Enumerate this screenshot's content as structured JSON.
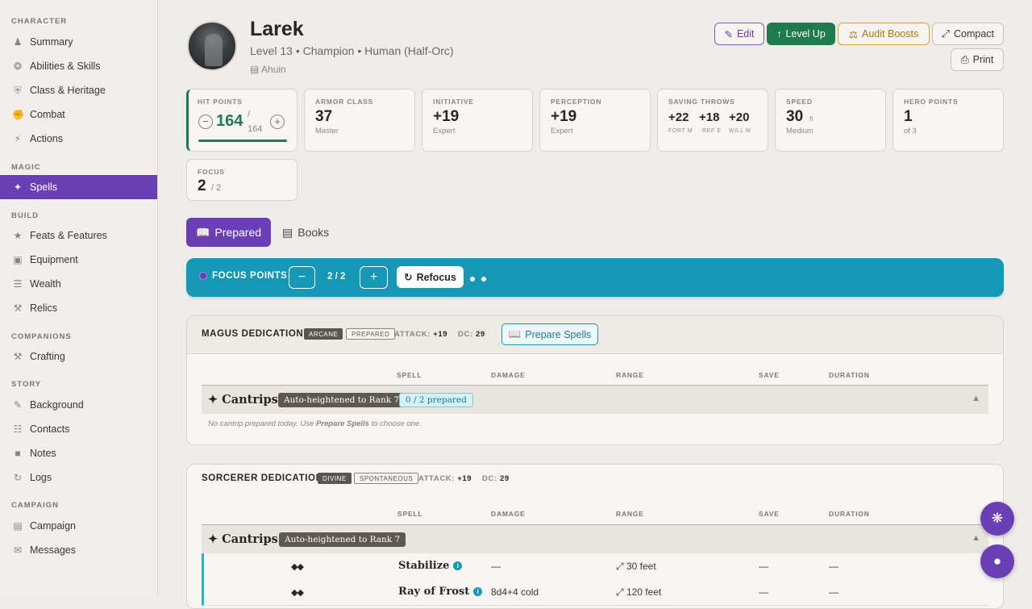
{
  "sidebar": {
    "sections": {
      "character": "CHARACTER",
      "magic": "MAGIC",
      "build": "BUILD",
      "companions": "COMPANIONS",
      "story": "STORY",
      "campaign": "CAMPAIGN"
    },
    "items": [
      {
        "label": "Summary",
        "icon": "person-icon"
      },
      {
        "label": "Abilities & Skills",
        "icon": "brain-icon"
      },
      {
        "label": "Class & Heritage",
        "icon": "shield-icon"
      },
      {
        "label": "Combat",
        "icon": "fist-icon"
      },
      {
        "label": "Actions",
        "icon": "bolt-icon"
      },
      {
        "label": "Spells",
        "icon": "wand-icon"
      },
      {
        "label": "Feats & Features",
        "icon": "star-icon"
      },
      {
        "label": "Equipment",
        "icon": "bag-icon"
      },
      {
        "label": "Wealth",
        "icon": "coins-icon"
      },
      {
        "label": "Relics",
        "icon": "relic-icon"
      },
      {
        "label": "Crafting",
        "icon": "hammer-icon"
      },
      {
        "label": "Background",
        "icon": "scroll-icon"
      },
      {
        "label": "Contacts",
        "icon": "address-book-icon"
      },
      {
        "label": "Notes",
        "icon": "note-icon"
      },
      {
        "label": "Logs",
        "icon": "history-icon"
      },
      {
        "label": "Campaign",
        "icon": "map-icon"
      },
      {
        "label": "Messages",
        "icon": "chat-icon"
      }
    ],
    "active": "Spells"
  },
  "header": {
    "name": "Larek",
    "subtitle": "Level 13  •  Champion  •  Human (Half-Orc)",
    "location": "Ahuin",
    "buttons": {
      "edit": "Edit",
      "level_up": "Level Up",
      "audit": "Audit Boosts",
      "compact": "Compact",
      "print": "Print"
    }
  },
  "stats": {
    "hp": {
      "label": "HIT POINTS",
      "current": "164",
      "max": "164",
      "sep": "/"
    },
    "ac": {
      "label": "ARMOR CLASS",
      "value": "37",
      "sub": "Master"
    },
    "init": {
      "label": "INITIATIVE",
      "value": "+19",
      "sub": "Expert"
    },
    "perc": {
      "label": "PERCEPTION",
      "value": "+19",
      "sub": "Expert"
    },
    "saves": {
      "label": "SAVING THROWS",
      "fort": "+22",
      "ref": "+18",
      "will": "+20",
      "fort_l": "FORT M",
      "ref_l": "REF E",
      "will_l": "WILL M"
    },
    "speed": {
      "label": "SPEED",
      "value": "30",
      "unit": "ft",
      "sub": "Medium"
    },
    "hero": {
      "label": "HERO POINTS",
      "value": "1",
      "sub": "of 3"
    },
    "focus": {
      "label": "FOCUS",
      "value": "2",
      "max": "/ 2"
    }
  },
  "tabs": {
    "prepared": "Prepared",
    "books": "Books"
  },
  "focusbar": {
    "title": "FOCUS POINTS",
    "count": "2 / 2",
    "refocus": "Refocus",
    "pips": 2
  },
  "columns": {
    "spell": "SPELL",
    "damage": "DAMAGE",
    "range": "RANGE",
    "save": "SAVE",
    "duration": "DURATION"
  },
  "magus": {
    "title": "MAGUS DEDICATION",
    "tradition": "ARCANE",
    "type": "PREPARED",
    "attack_l": "ATTACK:",
    "attack": "+19",
    "dc_l": "DC:",
    "dc": "29",
    "prepare_btn": "Prepare Spells",
    "rank": "Cantrips",
    "heighten": "Auto-heightened to Rank 7",
    "prepared": "0 / 2 prepared",
    "empty_pre": "No cantrip prepared today. Use ",
    "empty_b": "Prepare Spells",
    "empty_post": " to choose one."
  },
  "sorcerer": {
    "title": "SORCERER DEDICATION",
    "tradition": "DIVINE",
    "type": "SPONTANEOUS",
    "attack_l": "ATTACK:",
    "attack": "+19",
    "dc_l": "DC:",
    "dc": "29",
    "rank": "Cantrips",
    "heighten": "Auto-heightened to Rank 7",
    "spells": [
      {
        "actions": "◆◆",
        "name": "Stabilize",
        "damage": "—",
        "range": "30 feet",
        "save": "—",
        "duration": "—"
      },
      {
        "actions": "◆◆",
        "name": "Ray of Frost",
        "damage": "8d4+4 cold",
        "range": "120 feet",
        "save": "—",
        "duration": "—"
      }
    ]
  },
  "colors": {
    "accent": "#6a3fb5",
    "teal": "#1597b6",
    "green": "#1f7a4d",
    "gold": "#d4a62a"
  }
}
